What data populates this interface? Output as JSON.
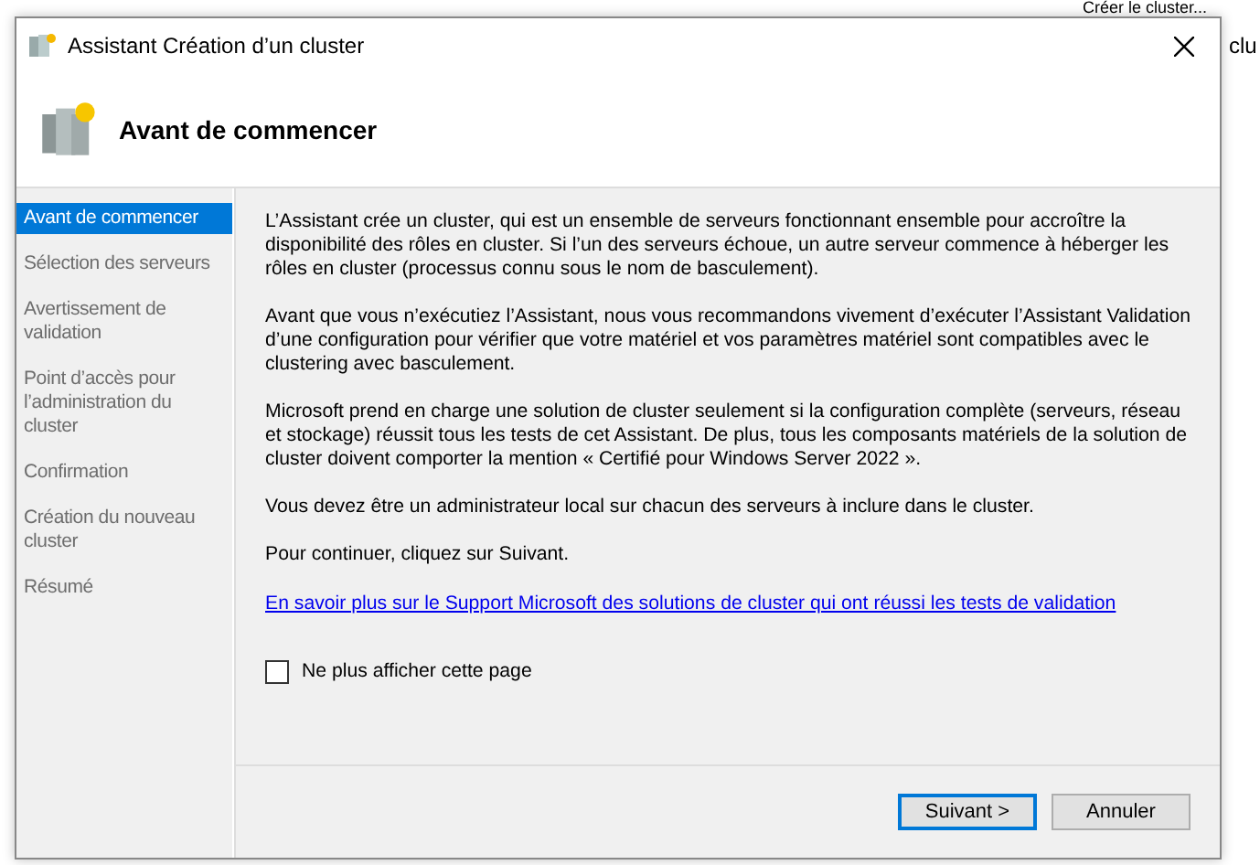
{
  "background": {
    "items": [
      "Créer le cluster...",
      "clu"
    ]
  },
  "window": {
    "title": "Assistant Création d’un cluster"
  },
  "header": {
    "title": "Avant de commencer"
  },
  "steps": [
    {
      "label": "Avant de commencer",
      "selected": true
    },
    {
      "label": "Sélection des serveurs",
      "selected": false
    },
    {
      "label": "Avertissement de validation",
      "selected": false
    },
    {
      "label": "Point d’accès pour l’administration du cluster",
      "selected": false
    },
    {
      "label": "Confirmation",
      "selected": false
    },
    {
      "label": "Création du nouveau cluster",
      "selected": false
    },
    {
      "label": "Résumé",
      "selected": false
    }
  ],
  "paragraphs": [
    "L’Assistant crée un cluster, qui est un ensemble de serveurs fonctionnant ensemble pour accroître la disponibilité des rôles en cluster. Si l’un des serveurs échoue, un autre serveur commence à héberger les rôles en cluster (processus connu sous le nom de basculement).",
    "Avant que vous n’exécutiez l’Assistant, nous vous recommandons vivement d’exécuter l’Assistant Validation d’une configuration pour vérifier que votre matériel et vos paramètres matériel sont compatibles avec le clustering avec basculement.",
    "Microsoft prend en charge une solution de cluster seulement si la configuration complète (serveurs, réseau et stockage) réussit tous les tests de cet Assistant. De plus, tous les composants matériels de la solution de cluster doivent comporter la mention « Certifié pour Windows Server 2022 ».",
    "Vous devez être un administrateur local sur chacun des serveurs à inclure dans le cluster.",
    "Pour continuer, cliquez sur Suivant."
  ],
  "link": "En savoir plus sur le Support Microsoft des solutions de cluster qui ont réussi les tests de validation",
  "checkbox": {
    "label": "Ne plus afficher cette page",
    "checked": false
  },
  "buttons": [
    {
      "label": "Suivant >",
      "default": true
    },
    {
      "label": "Annuler",
      "default": false
    }
  ]
}
